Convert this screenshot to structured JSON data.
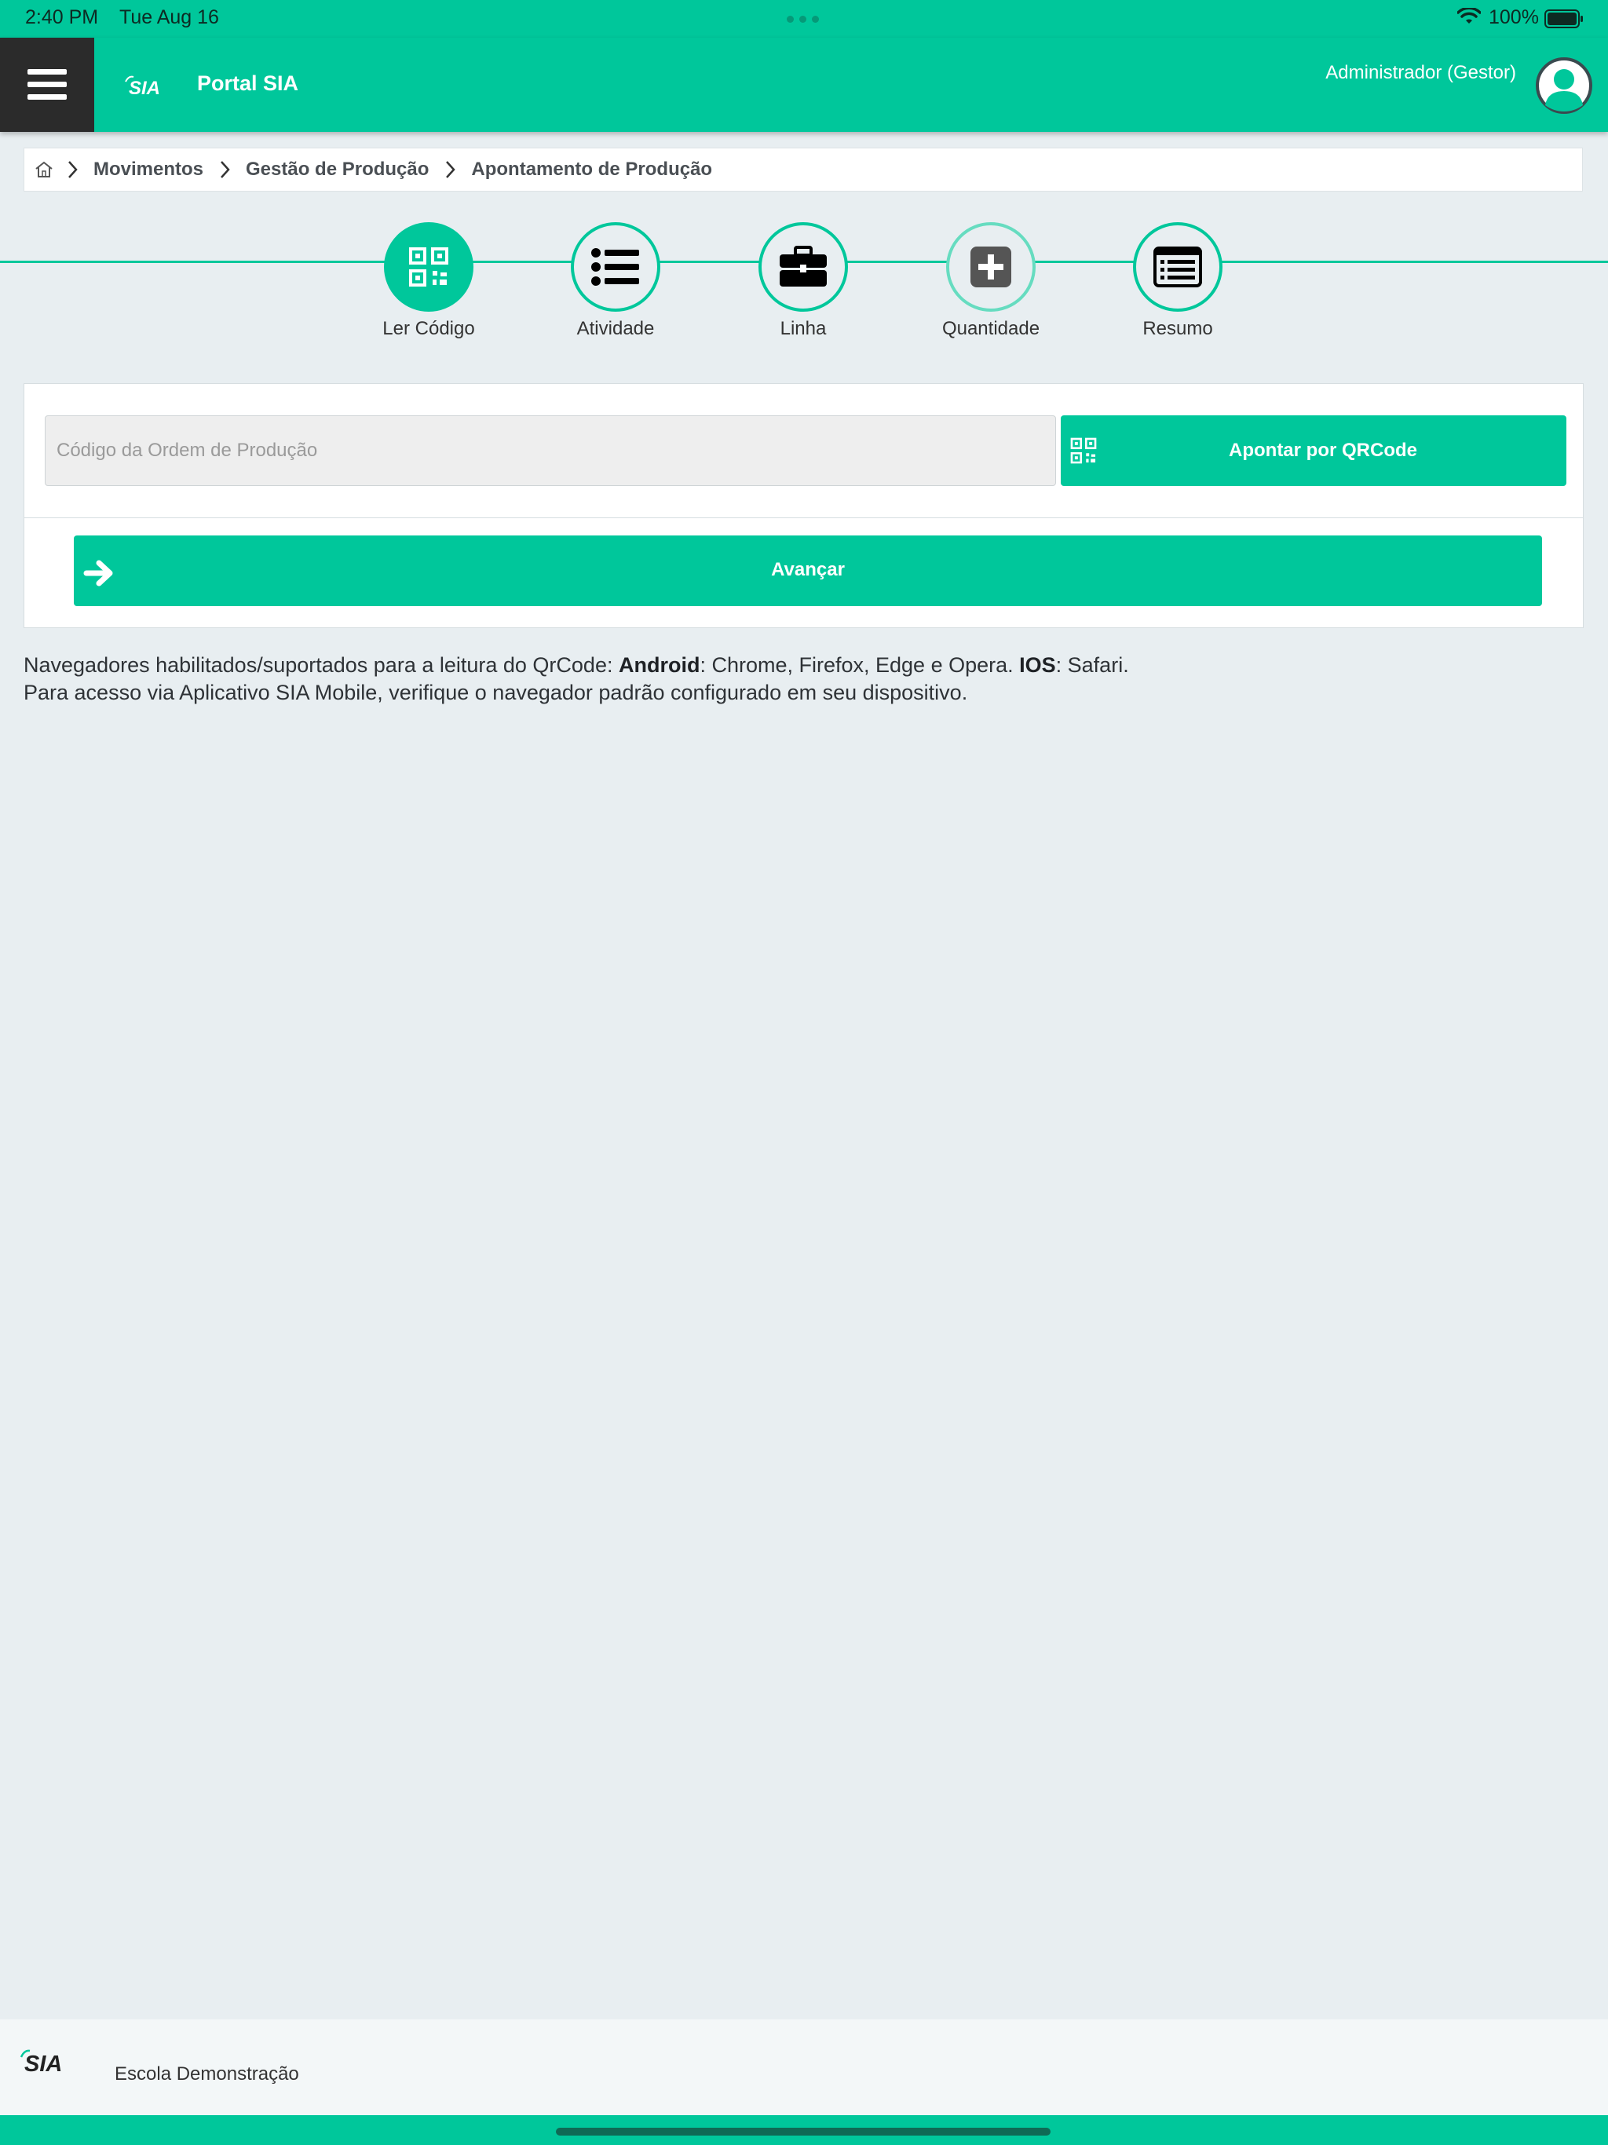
{
  "status_bar": {
    "time": "2:40 PM",
    "date": "Tue Aug 16",
    "battery": "100%"
  },
  "header": {
    "app_title": "Portal SIA",
    "user": "Administrador (Gestor)"
  },
  "breadcrumb": [
    "Movimentos",
    "Gestão de Produção",
    "Apontamento de Produção"
  ],
  "steps": [
    {
      "label": "Ler Código",
      "icon": "qrcode-icon",
      "state": "active"
    },
    {
      "label": "Atividade",
      "icon": "list-icon",
      "state": "default"
    },
    {
      "label": "Linha",
      "icon": "briefcase-icon",
      "state": "default"
    },
    {
      "label": "Quantidade",
      "icon": "plus-square-icon",
      "state": "disabled"
    },
    {
      "label": "Resumo",
      "icon": "summary-list-icon",
      "state": "default"
    }
  ],
  "form": {
    "code_placeholder": "Código da Ordem de Produção",
    "code_value": "",
    "qr_button": "Apontar por QRCode",
    "advance_button": "Avançar"
  },
  "info": {
    "line1_prefix": "Navegadores habilitados/suportados para a leitura do QrCode: ",
    "android_label": "Android",
    "android_text": ": Chrome, Firefox, Edge e Opera. ",
    "ios_label": "IOS",
    "ios_text": ": Safari.",
    "line2": "Para acesso via Aplicativo SIA Mobile, verifique o navegador padrão configurado em seu dispositivo."
  },
  "footer": {
    "school": "Escola Demonstração"
  },
  "colors": {
    "brand": "#00c79b",
    "menu_dark": "#2b2b2b",
    "background": "#e8eef1"
  }
}
